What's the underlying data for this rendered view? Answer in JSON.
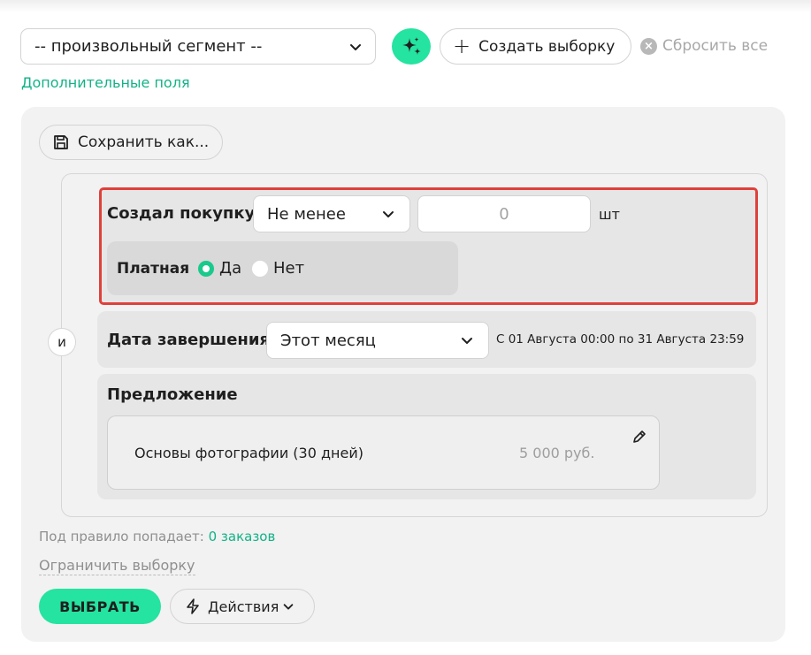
{
  "toolbar": {
    "segment_value": "-- произвольный сегмент --",
    "create_label": "Создать выборку",
    "reset_label": "Сбросить все",
    "extra_fields_label": "Дополнительные поля"
  },
  "panel": {
    "save_as_label": "Сохранить как...",
    "and_label": "и",
    "purchase": {
      "label": "Создал покупку",
      "operator": "Не менее",
      "count_value": "0",
      "unit": "шт",
      "paid_label": "Платная",
      "options": [
        "Да",
        "Нет"
      ],
      "selected": "Да"
    },
    "date": {
      "label": "Дата завершения",
      "value": "Этот месяц",
      "period_text": "С 01 Августа 00:00 по 31 Августа 23:59"
    },
    "offer": {
      "label": "Предложение",
      "name": "Основы фотографии (30 дней)",
      "price": "5 000 руб."
    },
    "rule_match_prefix": "Под правило попадает:",
    "rule_match_count": "0 заказов",
    "limit_label": "Ограничить выборку",
    "select_label": "ВЫБРАТЬ",
    "actions_label": "Действия"
  },
  "colors": {
    "accent": "#25e3a0",
    "link": "#12b286",
    "highlight_border": "#e0403a"
  }
}
